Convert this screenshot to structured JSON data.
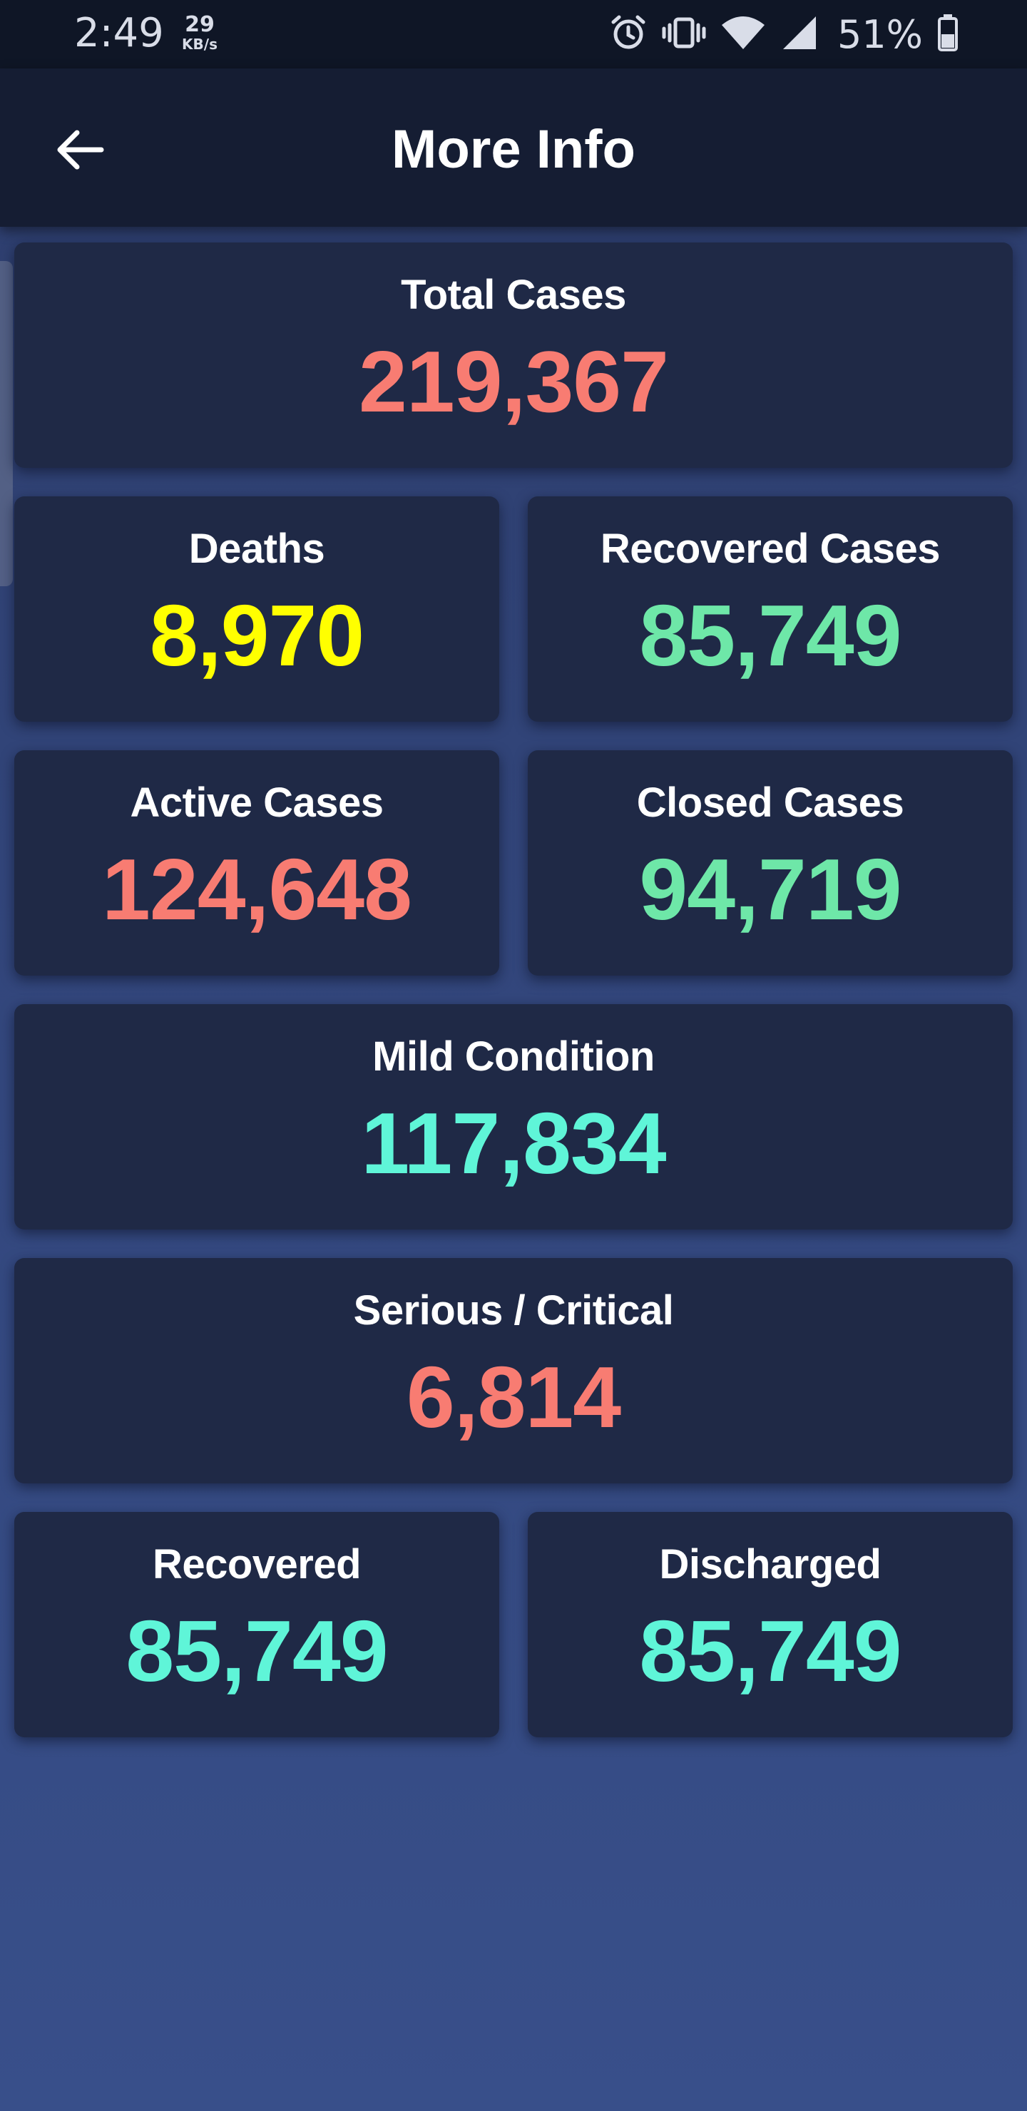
{
  "status_bar": {
    "time": "2:49",
    "net_speed_value": "29",
    "net_speed_unit": "KB/s",
    "battery_percent": "51%",
    "icons": [
      "alarm-icon",
      "vibrate-icon",
      "wifi-icon",
      "signal-icon",
      "battery-icon"
    ]
  },
  "app_bar": {
    "title": "More Info",
    "back_icon": "arrow-left-icon"
  },
  "colors": {
    "salmon": "#f87c72",
    "yellow": "#ffff00",
    "green": "#6ee7a8",
    "mint": "#5ff5d8",
    "card_bg": "#1f2946",
    "appbar_bg": "#151d33"
  },
  "stats": {
    "total_cases": {
      "label": "Total Cases",
      "value": "219,367"
    },
    "deaths": {
      "label": "Deaths",
      "value": "8,970"
    },
    "recovered_cases": {
      "label": "Recovered Cases",
      "value": "85,749"
    },
    "active_cases": {
      "label": "Active Cases",
      "value": "124,648"
    },
    "closed_cases": {
      "label": "Closed Cases",
      "value": "94,719"
    },
    "mild_condition": {
      "label": "Mild Condition",
      "value": "117,834"
    },
    "serious_critical": {
      "label": "Serious / Critical",
      "value": "6,814"
    },
    "recovered": {
      "label": "Recovered",
      "value": "85,749"
    },
    "discharged": {
      "label": "Discharged",
      "value": "85,749"
    }
  }
}
